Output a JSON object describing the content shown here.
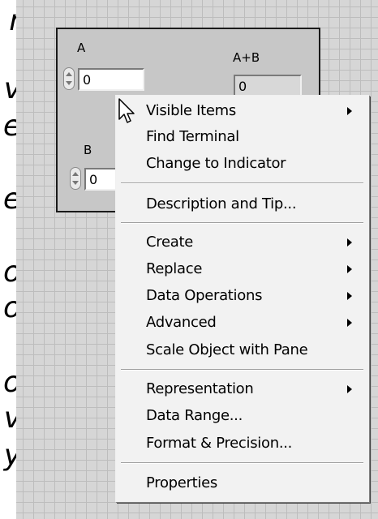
{
  "left_margin_glyphs": [
    "r",
    "v",
    "e",
    "e",
    "o",
    "o",
    "o",
    "v",
    "y"
  ],
  "panel": {
    "control_a": {
      "label": "A",
      "value": "0"
    },
    "indicator_sum": {
      "label": "A+B",
      "value": "0"
    },
    "control_b": {
      "label": "B",
      "value": "0"
    }
  },
  "context_menu": {
    "items": [
      {
        "label": "Visible Items",
        "submenu": true
      },
      {
        "label": "Find Terminal",
        "submenu": false
      },
      {
        "label": "Change to Indicator",
        "submenu": false
      },
      {
        "label": "Description and Tip...",
        "submenu": false
      },
      {
        "label": "Create",
        "submenu": true
      },
      {
        "label": "Replace",
        "submenu": true
      },
      {
        "label": "Data Operations",
        "submenu": true
      },
      {
        "label": "Advanced",
        "submenu": true
      },
      {
        "label": "Scale Object with Pane",
        "submenu": false
      },
      {
        "label": "Representation",
        "submenu": true
      },
      {
        "label": "Data Range...",
        "submenu": false
      },
      {
        "label": "Format & Precision...",
        "submenu": false
      },
      {
        "label": "Properties",
        "submenu": false
      }
    ]
  }
}
